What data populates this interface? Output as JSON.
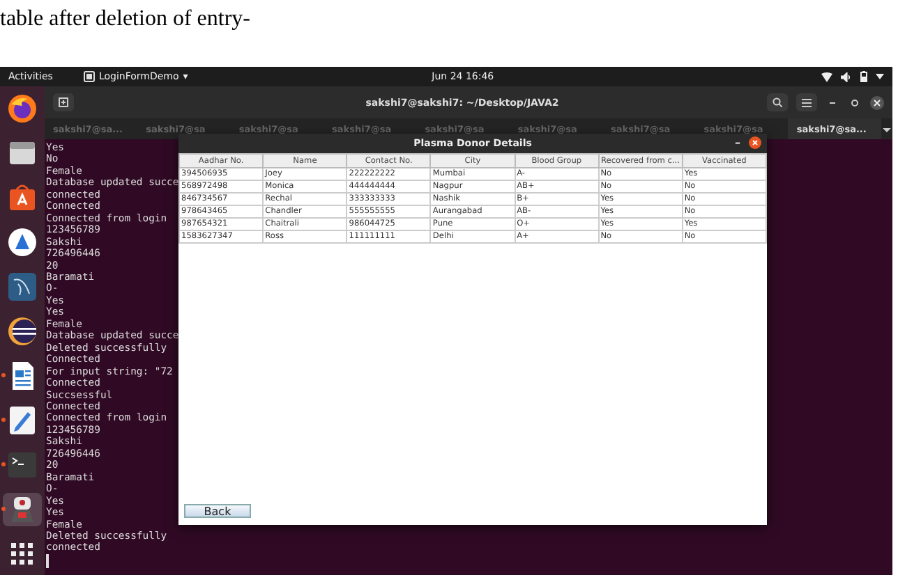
{
  "caption": "table after deletion of entry-",
  "top_bar": {
    "activities": "Activities",
    "app": "LoginFormDemo",
    "app_caret": "▾",
    "clock": "Jun 24  16:46"
  },
  "dock": [
    {
      "kind": "browser",
      "running": false
    },
    {
      "kind": "folder",
      "running": false
    },
    {
      "kind": "bag",
      "running": false
    },
    {
      "kind": "blue",
      "running": false
    },
    {
      "kind": "dolphin",
      "running": false
    },
    {
      "kind": "eclipse",
      "running": false
    },
    {
      "kind": "document",
      "running": true
    },
    {
      "kind": "pencil",
      "running": true
    },
    {
      "kind": "terminal",
      "running": true
    },
    {
      "kind": "robot",
      "running": true,
      "selected": true
    },
    {
      "kind": "grid",
      "running": false
    }
  ],
  "terminal": {
    "title": "sakshi7@sakshi7: ~/Desktop/JAVA2",
    "tabs": [
      {
        "label": "sakshi7@sa...",
        "selected": false
      },
      {
        "label": "sakshi7@sa",
        "selected": false
      },
      {
        "label": "sakshi7@sa",
        "selected": false
      },
      {
        "label": "sakshi7@sa",
        "selected": false
      },
      {
        "label": "sakshi7@sa",
        "selected": false
      },
      {
        "label": "sakshi7@sa",
        "selected": false
      },
      {
        "label": "sakshi7@sa",
        "selected": false
      },
      {
        "label": "sakshi7@sa",
        "selected": false
      },
      {
        "label": "sakshi7@sa...",
        "selected": true
      }
    ],
    "lines": [
      "Yes",
      "No",
      "Female",
      "Database updated succe",
      "connected",
      "Connected",
      "Connected from login",
      "123456789",
      "Sakshi",
      "726496446",
      "20",
      "Baramati",
      "O-",
      "Yes",
      "Yes",
      "Female",
      "Database updated succe",
      "Deleted successfully",
      "Connected",
      "For input string: \"72",
      "Connected",
      "Succsessful",
      "Connected",
      "Connected from login",
      "123456789",
      "Sakshi",
      "726496446",
      "20",
      "Baramati",
      "O-",
      "Yes",
      "Yes",
      "Female",
      "Deleted successfully",
      "connected"
    ]
  },
  "dialog": {
    "title": "Plasma Donor Details",
    "minimize": "–",
    "table": {
      "columns": [
        "Aadhar No.",
        "Name",
        "Contact No.",
        "City",
        "Blood Group",
        "Recovered from c...",
        "Vaccinated"
      ],
      "rows": [
        [
          "394506935",
          "Joey",
          "222222222",
          "Mumbai",
          "A-",
          "No",
          "Yes"
        ],
        [
          "568972498",
          "Monica",
          "444444444",
          "Nagpur",
          "AB+",
          "No",
          "No"
        ],
        [
          "846734567",
          "Rechal",
          "333333333",
          "Nashik",
          "B+",
          "Yes",
          "No"
        ],
        [
          "978643465",
          "Chandler",
          "555555555",
          "Aurangabad",
          "AB-",
          "Yes",
          "No"
        ],
        [
          "987654321",
          "Chaitrali",
          "986044725",
          "Pune",
          "O+",
          "Yes",
          "Yes"
        ],
        [
          "1583627347",
          "Ross",
          "111111111",
          "Delhi",
          "A+",
          "No",
          "No"
        ]
      ]
    },
    "back_button": "Back"
  }
}
